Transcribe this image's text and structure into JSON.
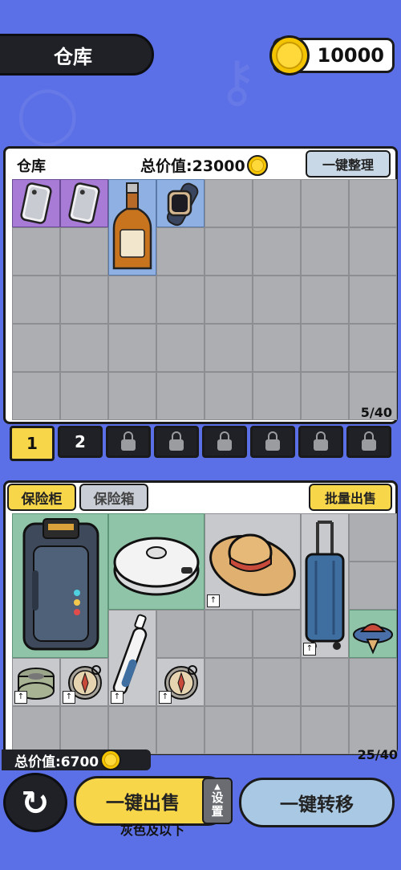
{
  "header": {
    "title": "仓库",
    "coins": "10000"
  },
  "warehouse": {
    "label": "仓库",
    "total_label": "总价值:23000",
    "sort_button": "一键整理",
    "capacity": "5/40",
    "items": [
      {
        "name": "phone-case",
        "rarity_color": "#a77bd6"
      },
      {
        "name": "phone-case",
        "rarity_color": "#a77bd6"
      },
      {
        "name": "whiskey-bottle",
        "rarity_color": "#8fb0e3"
      },
      {
        "name": "smart-watch",
        "rarity_color": "#8fb0e3"
      }
    ]
  },
  "pages": {
    "tab1": "1",
    "tab2": "2",
    "locked_count": 6
  },
  "vault": {
    "tab_active": "保险柜",
    "tab_idle": "保险箱",
    "batch_sell": "批量出售",
    "total_label": "总价值:6700",
    "capacity": "25/40",
    "upgrade_marker": "↑",
    "items": [
      {
        "name": "power-bank",
        "rarity_color": "#8fc4a8"
      },
      {
        "name": "robot-vacuum",
        "rarity_color": "#8fc4a8"
      },
      {
        "name": "straw-hat"
      },
      {
        "name": "suitcase"
      },
      {
        "name": "spinning-top",
        "rarity_color": "#8fc4a8"
      },
      {
        "name": "tape-roll"
      },
      {
        "name": "compass"
      },
      {
        "name": "electric-toothbrush"
      },
      {
        "name": "compass"
      }
    ]
  },
  "bottom": {
    "sell_button": "一键出售",
    "settings_l1": "设",
    "settings_l2": "置",
    "sell_sub": "灰色及以下",
    "transfer_button": "一键转移"
  },
  "colors": {
    "background": "#5b6fe6",
    "yellow": "#f8d64a",
    "dark": "#1f2126"
  }
}
